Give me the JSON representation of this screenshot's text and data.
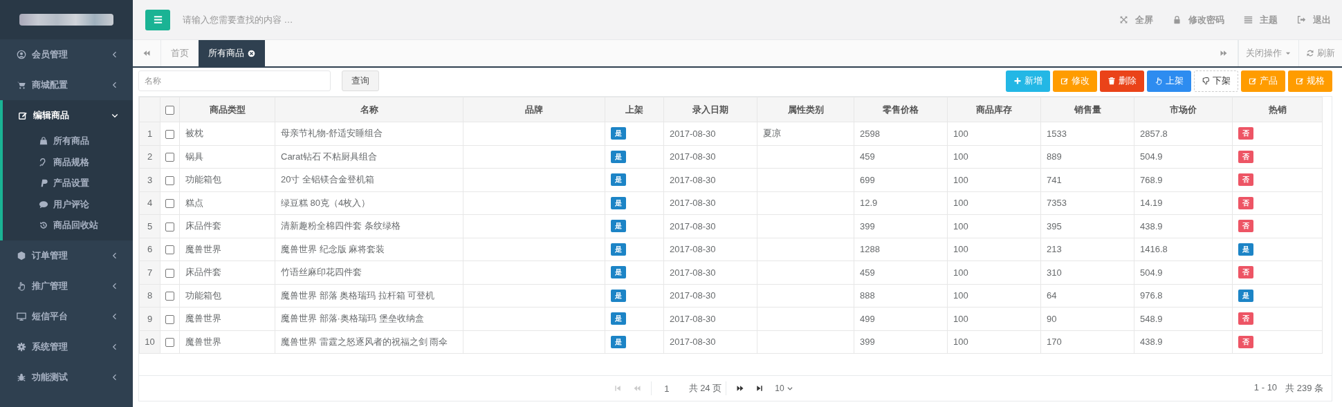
{
  "sidebar": {
    "items": [
      {
        "label": "会员管理",
        "expanded": false
      },
      {
        "label": "商城配置",
        "expanded": false
      },
      {
        "label": "编辑商品",
        "expanded": true,
        "children": [
          {
            "label": "所有商品"
          },
          {
            "label": "商品规格"
          },
          {
            "label": "产品设置"
          },
          {
            "label": "用户评论"
          },
          {
            "label": "商品回收站"
          }
        ]
      },
      {
        "label": "订单管理",
        "expanded": false
      },
      {
        "label": "推广管理",
        "expanded": false
      },
      {
        "label": "短信平台",
        "expanded": false
      },
      {
        "label": "系统管理",
        "expanded": false
      },
      {
        "label": "功能测试",
        "expanded": false
      }
    ]
  },
  "header": {
    "search_placeholder": "请输入您需要查找的内容 …",
    "actions": [
      {
        "label": "全屏"
      },
      {
        "label": "修改密码"
      },
      {
        "label": "主题"
      },
      {
        "label": "退出"
      }
    ]
  },
  "tabs": [
    {
      "label": "首页",
      "selected": false,
      "closable": false
    },
    {
      "label": "所有商品",
      "selected": true,
      "closable": true
    }
  ],
  "tab_tools": {
    "close_menu": "关闭操作",
    "refresh": "刷新"
  },
  "filter": {
    "placeholder": "名称",
    "button": "查询"
  },
  "toolbar": [
    {
      "label": "新增",
      "kind": "info"
    },
    {
      "label": "修改",
      "kind": "warning"
    },
    {
      "label": "删除",
      "kind": "danger"
    },
    {
      "label": "上架",
      "kind": "primary"
    },
    {
      "label": "下架",
      "kind": "outline"
    },
    {
      "label": "产品",
      "kind": "warning"
    },
    {
      "label": "规格",
      "kind": "warning"
    }
  ],
  "table": {
    "select_all": false,
    "columns": [
      "商品类型",
      "名称",
      "品牌",
      "上架",
      "录入日期",
      "属性类别",
      "零售价格",
      "商品库存",
      "销售量",
      "市场价",
      "热销"
    ],
    "rows": [
      {
        "no": "1",
        "checked": false,
        "type": "被枕",
        "name": "母亲节礼物-舒适安睡组合",
        "listed": {
          "label": "是",
          "yes": true
        },
        "date": "2017-08-30",
        "attribute": "夏凉",
        "price": "2598",
        "stock": "100",
        "sales": "1533",
        "market": "2857.8",
        "hot": {
          "label": "否",
          "yes": false
        }
      },
      {
        "no": "2",
        "checked": false,
        "type": "锅具",
        "name": "Carat钻石 不粘厨具组合",
        "listed": {
          "label": "是",
          "yes": true
        },
        "date": "2017-08-30",
        "price": "459",
        "stock": "100",
        "sales": "889",
        "market": "504.9",
        "hot": {
          "label": "否",
          "yes": false
        }
      },
      {
        "no": "3",
        "checked": false,
        "type": "功能箱包",
        "name": "20寸 全铝镁合金登机箱",
        "listed": {
          "label": "是",
          "yes": true
        },
        "date": "2017-08-30",
        "price": "699",
        "stock": "100",
        "sales": "741",
        "market": "768.9",
        "hot": {
          "label": "否",
          "yes": false
        }
      },
      {
        "no": "4",
        "checked": false,
        "type": "糕点",
        "name": "绿豆糕 80克（4枚入）",
        "listed": {
          "label": "是",
          "yes": true
        },
        "date": "2017-08-30",
        "price": "12.9",
        "stock": "100",
        "sales": "7353",
        "market": "14.19",
        "hot": {
          "label": "否",
          "yes": false
        }
      },
      {
        "no": "5",
        "checked": false,
        "type": "床品件套",
        "name": "清新趣粉全棉四件套 条纹绿格",
        "listed": {
          "label": "是",
          "yes": true
        },
        "date": "2017-08-30",
        "price": "399",
        "stock": "100",
        "sales": "395",
        "market": "438.9",
        "hot": {
          "label": "否",
          "yes": false
        }
      },
      {
        "no": "6",
        "checked": false,
        "type": "魔兽世界",
        "name": "魔兽世界 纪念版 麻将套装",
        "listed": {
          "label": "是",
          "yes": true
        },
        "date": "2017-08-30",
        "price": "1288",
        "stock": "100",
        "sales": "213",
        "market": "1416.8",
        "hot": {
          "label": "是",
          "yes": true
        }
      },
      {
        "no": "7",
        "checked": false,
        "type": "床品件套",
        "name": "竹语丝麻印花四件套",
        "listed": {
          "label": "是",
          "yes": true
        },
        "date": "2017-08-30",
        "price": "459",
        "stock": "100",
        "sales": "310",
        "market": "504.9",
        "hot": {
          "label": "否",
          "yes": false
        }
      },
      {
        "no": "8",
        "checked": false,
        "type": "功能箱包",
        "name": "魔兽世界 部落 奥格瑞玛 拉杆箱 可登机",
        "listed": {
          "label": "是",
          "yes": true
        },
        "date": "2017-08-30",
        "price": "888",
        "stock": "100",
        "sales": "64",
        "market": "976.8",
        "hot": {
          "label": "是",
          "yes": true
        }
      },
      {
        "no": "9",
        "checked": false,
        "type": "魔兽世界",
        "name": "魔兽世界 部落·奥格瑞玛 堡垒收纳盒",
        "listed": {
          "label": "是",
          "yes": true
        },
        "date": "2017-08-30",
        "price": "499",
        "stock": "100",
        "sales": "90",
        "market": "548.9",
        "hot": {
          "label": "否",
          "yes": false
        }
      },
      {
        "no": "10",
        "checked": false,
        "type": "魔兽世界",
        "name": "魔兽世界 雷霆之怒逐风者的祝福之剑 雨伞",
        "listed": {
          "label": "是",
          "yes": true
        },
        "date": "2017-08-30",
        "price": "399",
        "stock": "100",
        "sales": "170",
        "market": "438.9",
        "hot": {
          "label": "否",
          "yes": false
        }
      }
    ]
  },
  "pagination": {
    "nav": [
      {
        "disabled": true
      },
      {
        "disabled": true
      },
      {
        "disabled": false
      },
      {
        "disabled": false
      }
    ],
    "page": "1",
    "total_pages": "共 24 页",
    "page_size": "10",
    "range": "1 - 10",
    "total": "共 239 条"
  }
}
